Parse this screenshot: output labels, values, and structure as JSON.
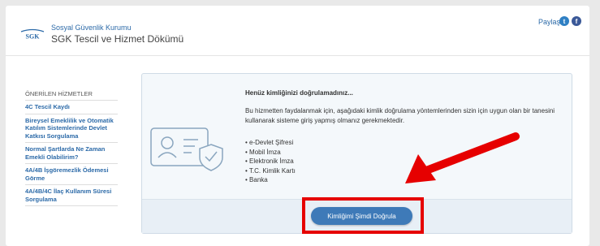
{
  "header": {
    "org_name": "Sosyal Güvenlik Kurumu",
    "service_title": "SGK Tescil ve Hizmet Dökümü",
    "logo_text": "SGK",
    "share_label": "Paylaş"
  },
  "sidebar": {
    "heading": "ÖNERİLEN HİZMETLER",
    "items": [
      {
        "label": "4C Tescil Kaydı"
      },
      {
        "label": "Bireysel Emeklilik ve Otomatik Katılım Sistemlerinde Devlet Katkısı Sorgulama"
      },
      {
        "label": "Normal Şartlarda Ne Zaman Emekli Olabilirim?"
      },
      {
        "label": "4A/4B İşgöremezlik Ödemesi Görme"
      },
      {
        "label": "4A/4B/4C İlaç Kullanım Süresi Sorgulama"
      }
    ]
  },
  "panel": {
    "title": "Henüz kimliğinizi doğrulamadınız...",
    "description": "Bu hizmetten faydalanmak için, aşağıdaki kimlik doğrulama yöntemlerinden sizin için uygun olan bir tanesini kullanarak sisteme giriş yapmış olmanız gerekmektedir.",
    "methods": [
      {
        "label": "e-Devlet Şifresi"
      },
      {
        "label": "Mobil İmza"
      },
      {
        "label": "Elektronik İmza"
      },
      {
        "label": "T.C. Kimlik Kartı"
      },
      {
        "label": "Banka"
      }
    ],
    "verify_button_label": "Kimliğimi Şimdi Doğrula"
  },
  "colors": {
    "accent": "#3e7ab8",
    "link": "#2c6aa8",
    "annotation_red": "#e60000"
  }
}
